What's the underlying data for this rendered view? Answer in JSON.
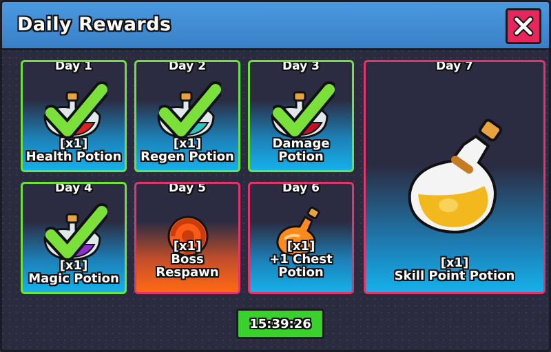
{
  "window": {
    "title": "Daily Rewards"
  },
  "rewards": [
    {
      "day": "Day 1",
      "qty": "[x1]",
      "name": "Health Potion",
      "claimed": true
    },
    {
      "day": "Day 2",
      "qty": "[x1]",
      "name": "Regen Potion",
      "claimed": true
    },
    {
      "day": "Day 3",
      "qty": "[x1]",
      "name_line1": "Damage",
      "name_line2": "Potion",
      "claimed": true
    },
    {
      "day": "Day 4",
      "qty": "[x1]",
      "name": "Magic Potion",
      "claimed": true
    },
    {
      "day": "Day 5",
      "qty": "[x1]",
      "name_line1": "Boss",
      "name_line2": "Respawn",
      "claimed": false
    },
    {
      "day": "Day 6",
      "qty": "[x1]",
      "name_line1": "+1 Chest",
      "name_line2": "Potion",
      "claimed": false
    },
    {
      "day": "Day 7",
      "qty": "[x1]",
      "name": "Skill Point Potion",
      "claimed": false
    }
  ],
  "timer": {
    "value": "15:39:26"
  },
  "icons": {
    "close": "close-icon",
    "check": "checkmark-icon",
    "health": "red-potion-icon",
    "regen": "teal-potion-icon",
    "damage": "red-potion-icon",
    "magic": "purple-potion-icon",
    "boss": "respawn-icon",
    "chest": "orange-potion-icon",
    "skill": "yellow-potion-icon"
  },
  "colors": {
    "header": "#3a7fc7",
    "close_button": "#e8265e",
    "claimed_border": "#6fe23a",
    "locked_border": "#e2356b",
    "timer_button": "#3ad12e"
  }
}
